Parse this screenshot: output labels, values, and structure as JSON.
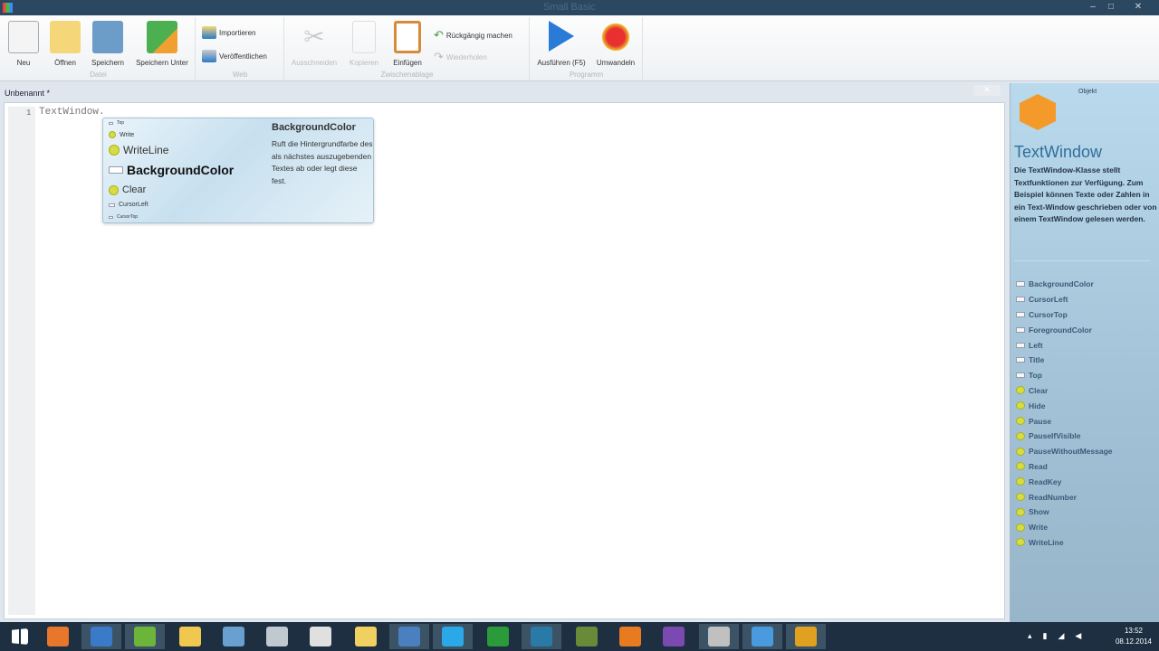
{
  "window": {
    "title": "Small Basic"
  },
  "ribbon": {
    "groups": [
      {
        "label": "Datei"
      },
      {
        "label": "Web"
      },
      {
        "label": "Zwischenablage"
      },
      {
        "label": "Programm"
      }
    ],
    "buttons": {
      "new": "Neu",
      "open": "Öffnen",
      "save": "Speichern",
      "save_as": "Speichern Unter",
      "import": "Importieren",
      "publish": "Veröffentlichen",
      "cut": "Ausschneiden",
      "copy": "Kopieren",
      "paste": "Einfügen",
      "undo": "Rückgängig machen",
      "redo": "Wiederholen",
      "run": "Ausführen (F5)",
      "convert": "Umwandeln"
    }
  },
  "editor": {
    "tab": "Unbenannt *",
    "line_number": "1",
    "code": "TextWindow."
  },
  "intellisense": {
    "items": [
      "Top",
      "Write",
      "WriteLine",
      "BackgroundColor",
      "Clear",
      "CursorLeft",
      "CursorTop"
    ],
    "selected": "BackgroundColor",
    "title": "BackgroundColor",
    "description": "Ruft die Hintergrundfarbe des als nächstes auszugebenden Textes ab oder legt diese fest."
  },
  "sidebar": {
    "small": "Objekt",
    "title": "TextWindow",
    "description": "Die TextWindow-Klasse stellt Textfunktionen zur Verfügung. Zum Beispiel können Texte oder Zahlen in ein Text-Window geschrieben oder von einem TextWindow gelesen werden.",
    "members": [
      {
        "name": "BackgroundColor",
        "kind": "property"
      },
      {
        "name": "CursorLeft",
        "kind": "property"
      },
      {
        "name": "CursorTop",
        "kind": "property"
      },
      {
        "name": "ForegroundColor",
        "kind": "property"
      },
      {
        "name": "Left",
        "kind": "property"
      },
      {
        "name": "Title",
        "kind": "property"
      },
      {
        "name": "Top",
        "kind": "property"
      },
      {
        "name": "Clear",
        "kind": "method"
      },
      {
        "name": "Hide",
        "kind": "method"
      },
      {
        "name": "Pause",
        "kind": "method"
      },
      {
        "name": "PauseIfVisible",
        "kind": "method"
      },
      {
        "name": "PauseWithoutMessage",
        "kind": "method"
      },
      {
        "name": "Read",
        "kind": "method"
      },
      {
        "name": "ReadKey",
        "kind": "method"
      },
      {
        "name": "ReadNumber",
        "kind": "method"
      },
      {
        "name": "Show",
        "kind": "method"
      },
      {
        "name": "Write",
        "kind": "method"
      },
      {
        "name": "WriteLine",
        "kind": "method"
      }
    ]
  },
  "taskbar": {
    "apps": [
      {
        "name": "start",
        "color": "#ffffff"
      },
      {
        "name": "firefox",
        "color": "#e8762b"
      },
      {
        "name": "outlook",
        "color": "#3a7ac8"
      },
      {
        "name": "spotify",
        "color": "#6cb43a"
      },
      {
        "name": "explorer",
        "color": "#f0c850"
      },
      {
        "name": "remote-desktop",
        "color": "#6aa0d0"
      },
      {
        "name": "printer",
        "color": "#c0c8d0"
      },
      {
        "name": "game-controller",
        "color": "#e0e0e0"
      },
      {
        "name": "folder-sync",
        "color": "#f0d060"
      },
      {
        "name": "network",
        "color": "#4a80c0"
      },
      {
        "name": "skype",
        "color": "#2aa8e8"
      },
      {
        "name": "xbox",
        "color": "#2a9a3a"
      },
      {
        "name": "visual-studio-blend",
        "color": "#2a7aa8"
      },
      {
        "name": "minecraft",
        "color": "#6a8a3a"
      },
      {
        "name": "blender",
        "color": "#e87a20"
      },
      {
        "name": "visual-studio",
        "color": "#7a4ab0"
      },
      {
        "name": "tools",
        "color": "#c0c0c0"
      },
      {
        "name": "small-basic",
        "color": "#4a9ae0"
      },
      {
        "name": "headphones",
        "color": "#e0a020"
      }
    ],
    "time": "13:52",
    "date": "08.12.2014"
  }
}
